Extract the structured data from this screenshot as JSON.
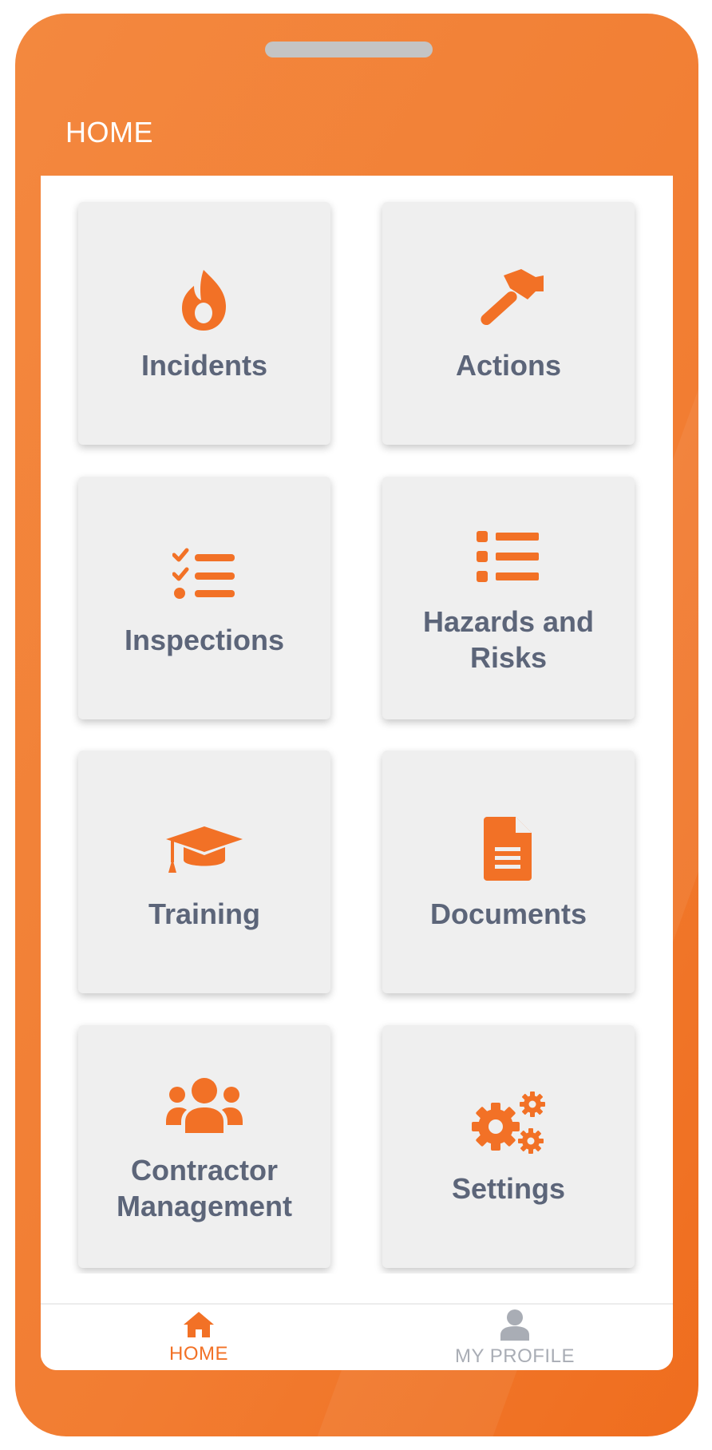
{
  "header": {
    "title": "HOME"
  },
  "colors": {
    "brand_orange": "#f27126",
    "tile_background": "#efefef",
    "label_gray": "#5c6579",
    "inactive_nav": "#a9adb5"
  },
  "tiles": [
    {
      "label": "Incidents",
      "icon": "flame-icon"
    },
    {
      "label": "Actions",
      "icon": "hammer-icon"
    },
    {
      "label": "Inspections",
      "icon": "checklist-icon"
    },
    {
      "label": "Hazards and Risks",
      "icon": "list-icon"
    },
    {
      "label": "Training",
      "icon": "graduation-cap-icon"
    },
    {
      "label": "Documents",
      "icon": "document-icon"
    },
    {
      "label": "Contractor Management",
      "icon": "users-icon"
    },
    {
      "label": "Settings",
      "icon": "gears-icon"
    }
  ],
  "bottom_nav": {
    "items": [
      {
        "label": "HOME",
        "icon": "home-icon",
        "active": true
      },
      {
        "label": "MY PROFILE",
        "icon": "user-icon",
        "active": false
      }
    ]
  }
}
